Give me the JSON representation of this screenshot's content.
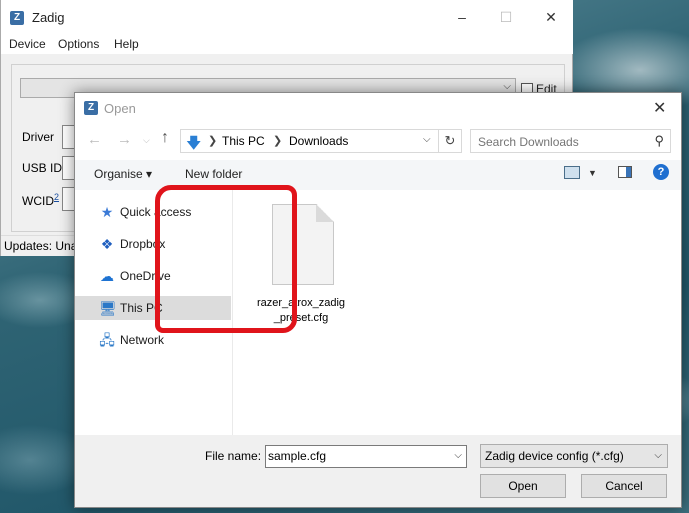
{
  "zadig": {
    "title": "Zadig",
    "app_icon_letter": "Z",
    "menu": [
      "Device",
      "Options",
      "Help"
    ],
    "edit_label": "Edit",
    "labels": {
      "driver": "Driver",
      "usb_id": "USB ID",
      "wcid": "WCID",
      "wcid_sup": "2"
    },
    "status_text": "Updates: Unal"
  },
  "dialog": {
    "title": "Open",
    "app_icon_letter": "Z",
    "breadcrumb": [
      "This PC",
      "Downloads"
    ],
    "search_placeholder": "Search Downloads",
    "toolbar": {
      "organise": "Organise ▾",
      "new_folder": "New folder"
    },
    "nav_items": [
      {
        "label": "Quick access",
        "icon": "star-icon"
      },
      {
        "label": "Dropbox",
        "icon": "dropbox-icon"
      },
      {
        "label": "OneDrive",
        "icon": "cloud-icon"
      },
      {
        "label": "This PC",
        "icon": "computer-icon",
        "selected": true
      },
      {
        "label": "Network",
        "icon": "network-icon"
      }
    ],
    "files": [
      {
        "name": "razer_atrox_zadig_preset.cfg",
        "display_line1": "razer_atrox_zadig",
        "display_line2": "_preset.cfg"
      }
    ],
    "file_name_label": "File name:",
    "file_name_value": "sample.cfg",
    "file_type_filter": "Zadig device config (*.cfg)",
    "open_button": "Open",
    "cancel_button": "Cancel"
  },
  "colors": {
    "highlight": "#e0141b",
    "accent": "#1f6fd0",
    "selected_nav": "#dcdcdc"
  }
}
